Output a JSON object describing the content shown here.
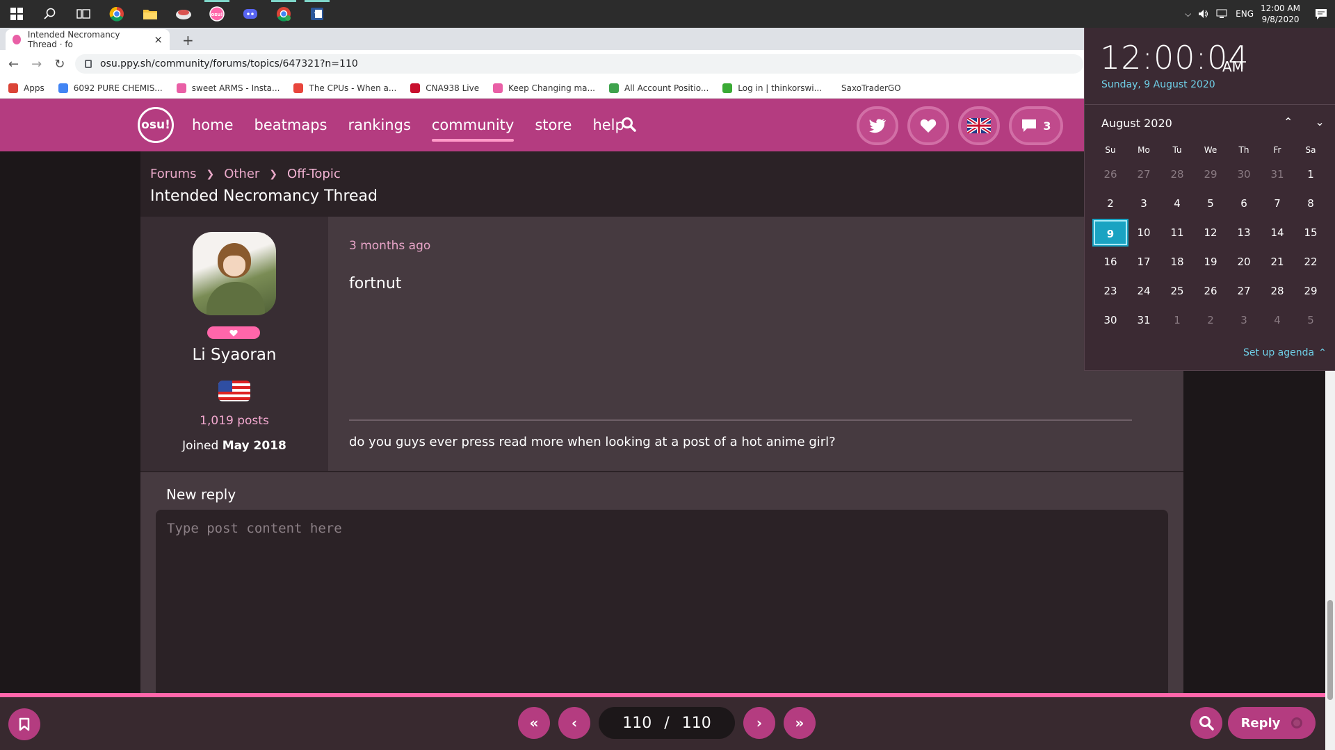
{
  "taskbar": {
    "icons": [
      {
        "name": "windows-start-icon",
        "color": "#2c2c2c"
      },
      {
        "name": "search-icon",
        "color": "#2c2c2c"
      },
      {
        "name": "task-view-icon",
        "color": "#2c2c2c"
      },
      {
        "name": "chrome-icon",
        "color": "#e8453c"
      },
      {
        "name": "file-explorer-icon",
        "color": "#f4c23d"
      },
      {
        "name": "app-icon",
        "color": "#d9534f"
      },
      {
        "name": "osu-icon",
        "color": "#ff66aa"
      },
      {
        "name": "discord-icon",
        "color": "#5865f2"
      },
      {
        "name": "chrome-alt-icon",
        "color": "#34a853"
      },
      {
        "name": "word-icon",
        "color": "#2b579a"
      }
    ],
    "lang": "ENG",
    "time": "12:00 AM",
    "date": "9/8/2020"
  },
  "browser": {
    "tab_title": "Intended Necromancy Thread · fo",
    "url": "osu.ppy.sh/community/forums/topics/647321?n=110",
    "bookmarks": [
      {
        "label": "Apps",
        "color": "#db4437"
      },
      {
        "label": "6092 PURE CHEMIS...",
        "color": "#4285f4"
      },
      {
        "label": "sweet ARMS - Insta...",
        "color": "#e95fa6"
      },
      {
        "label": "The CPUs - When a...",
        "color": "#e8453c"
      },
      {
        "label": "CNA938 Live",
        "color": "#c8102e"
      },
      {
        "label": "Keep Changing ma...",
        "color": "#e95fa6"
      },
      {
        "label": "All Account Positio...",
        "color": "#3fa34d"
      },
      {
        "label": "Log in | thinkorswi...",
        "color": "#3aaa35"
      },
      {
        "label": "SaxoTraderGO",
        "color": "#ffffff"
      }
    ]
  },
  "nav": {
    "logo": "osu!",
    "links": [
      "home",
      "beatmaps",
      "rankings",
      "community",
      "store",
      "help"
    ],
    "active_link": "community",
    "chat_count": "3"
  },
  "forum": {
    "breadcrumbs": [
      "Forums",
      "Other",
      "Off-Topic"
    ],
    "title": "Intended Necromancy Thread",
    "post": {
      "username": "Li Syaoran",
      "posts": "1,019 posts",
      "joined_prefix": "Joined",
      "joined_date": "May 2018",
      "time": "3 months ago",
      "text": "fortnut",
      "signature": "do you guys ever press read more when looking at a post of a hot anime girl?"
    },
    "reply": {
      "title": "New reply",
      "placeholder": "Type post content here"
    }
  },
  "pager": {
    "current": "110",
    "separator": "/",
    "total": "110",
    "reply_label": "Reply"
  },
  "flyout": {
    "time": "12:00:04",
    "ampm": "AM",
    "date": "Sunday, 9 August 2020",
    "month": "August 2020",
    "weekdays": [
      "Su",
      "Mo",
      "Tu",
      "We",
      "Th",
      "Fr",
      "Sa"
    ],
    "weeks": [
      [
        "26",
        "27",
        "28",
        "29",
        "30",
        "31",
        "1"
      ],
      [
        "2",
        "3",
        "4",
        "5",
        "6",
        "7",
        "8"
      ],
      [
        "9",
        "10",
        "11",
        "12",
        "13",
        "14",
        "15"
      ],
      [
        "16",
        "17",
        "18",
        "19",
        "20",
        "21",
        "22"
      ],
      [
        "23",
        "24",
        "25",
        "26",
        "27",
        "28",
        "29"
      ],
      [
        "30",
        "31",
        "1",
        "2",
        "3",
        "4",
        "5"
      ]
    ],
    "today": "9",
    "agenda": "Set up agenda"
  },
  "colors": {
    "osu_pink": "#ff66aa",
    "nav_bg": "#b43c80",
    "accent_blue": "#1aa3c2"
  }
}
